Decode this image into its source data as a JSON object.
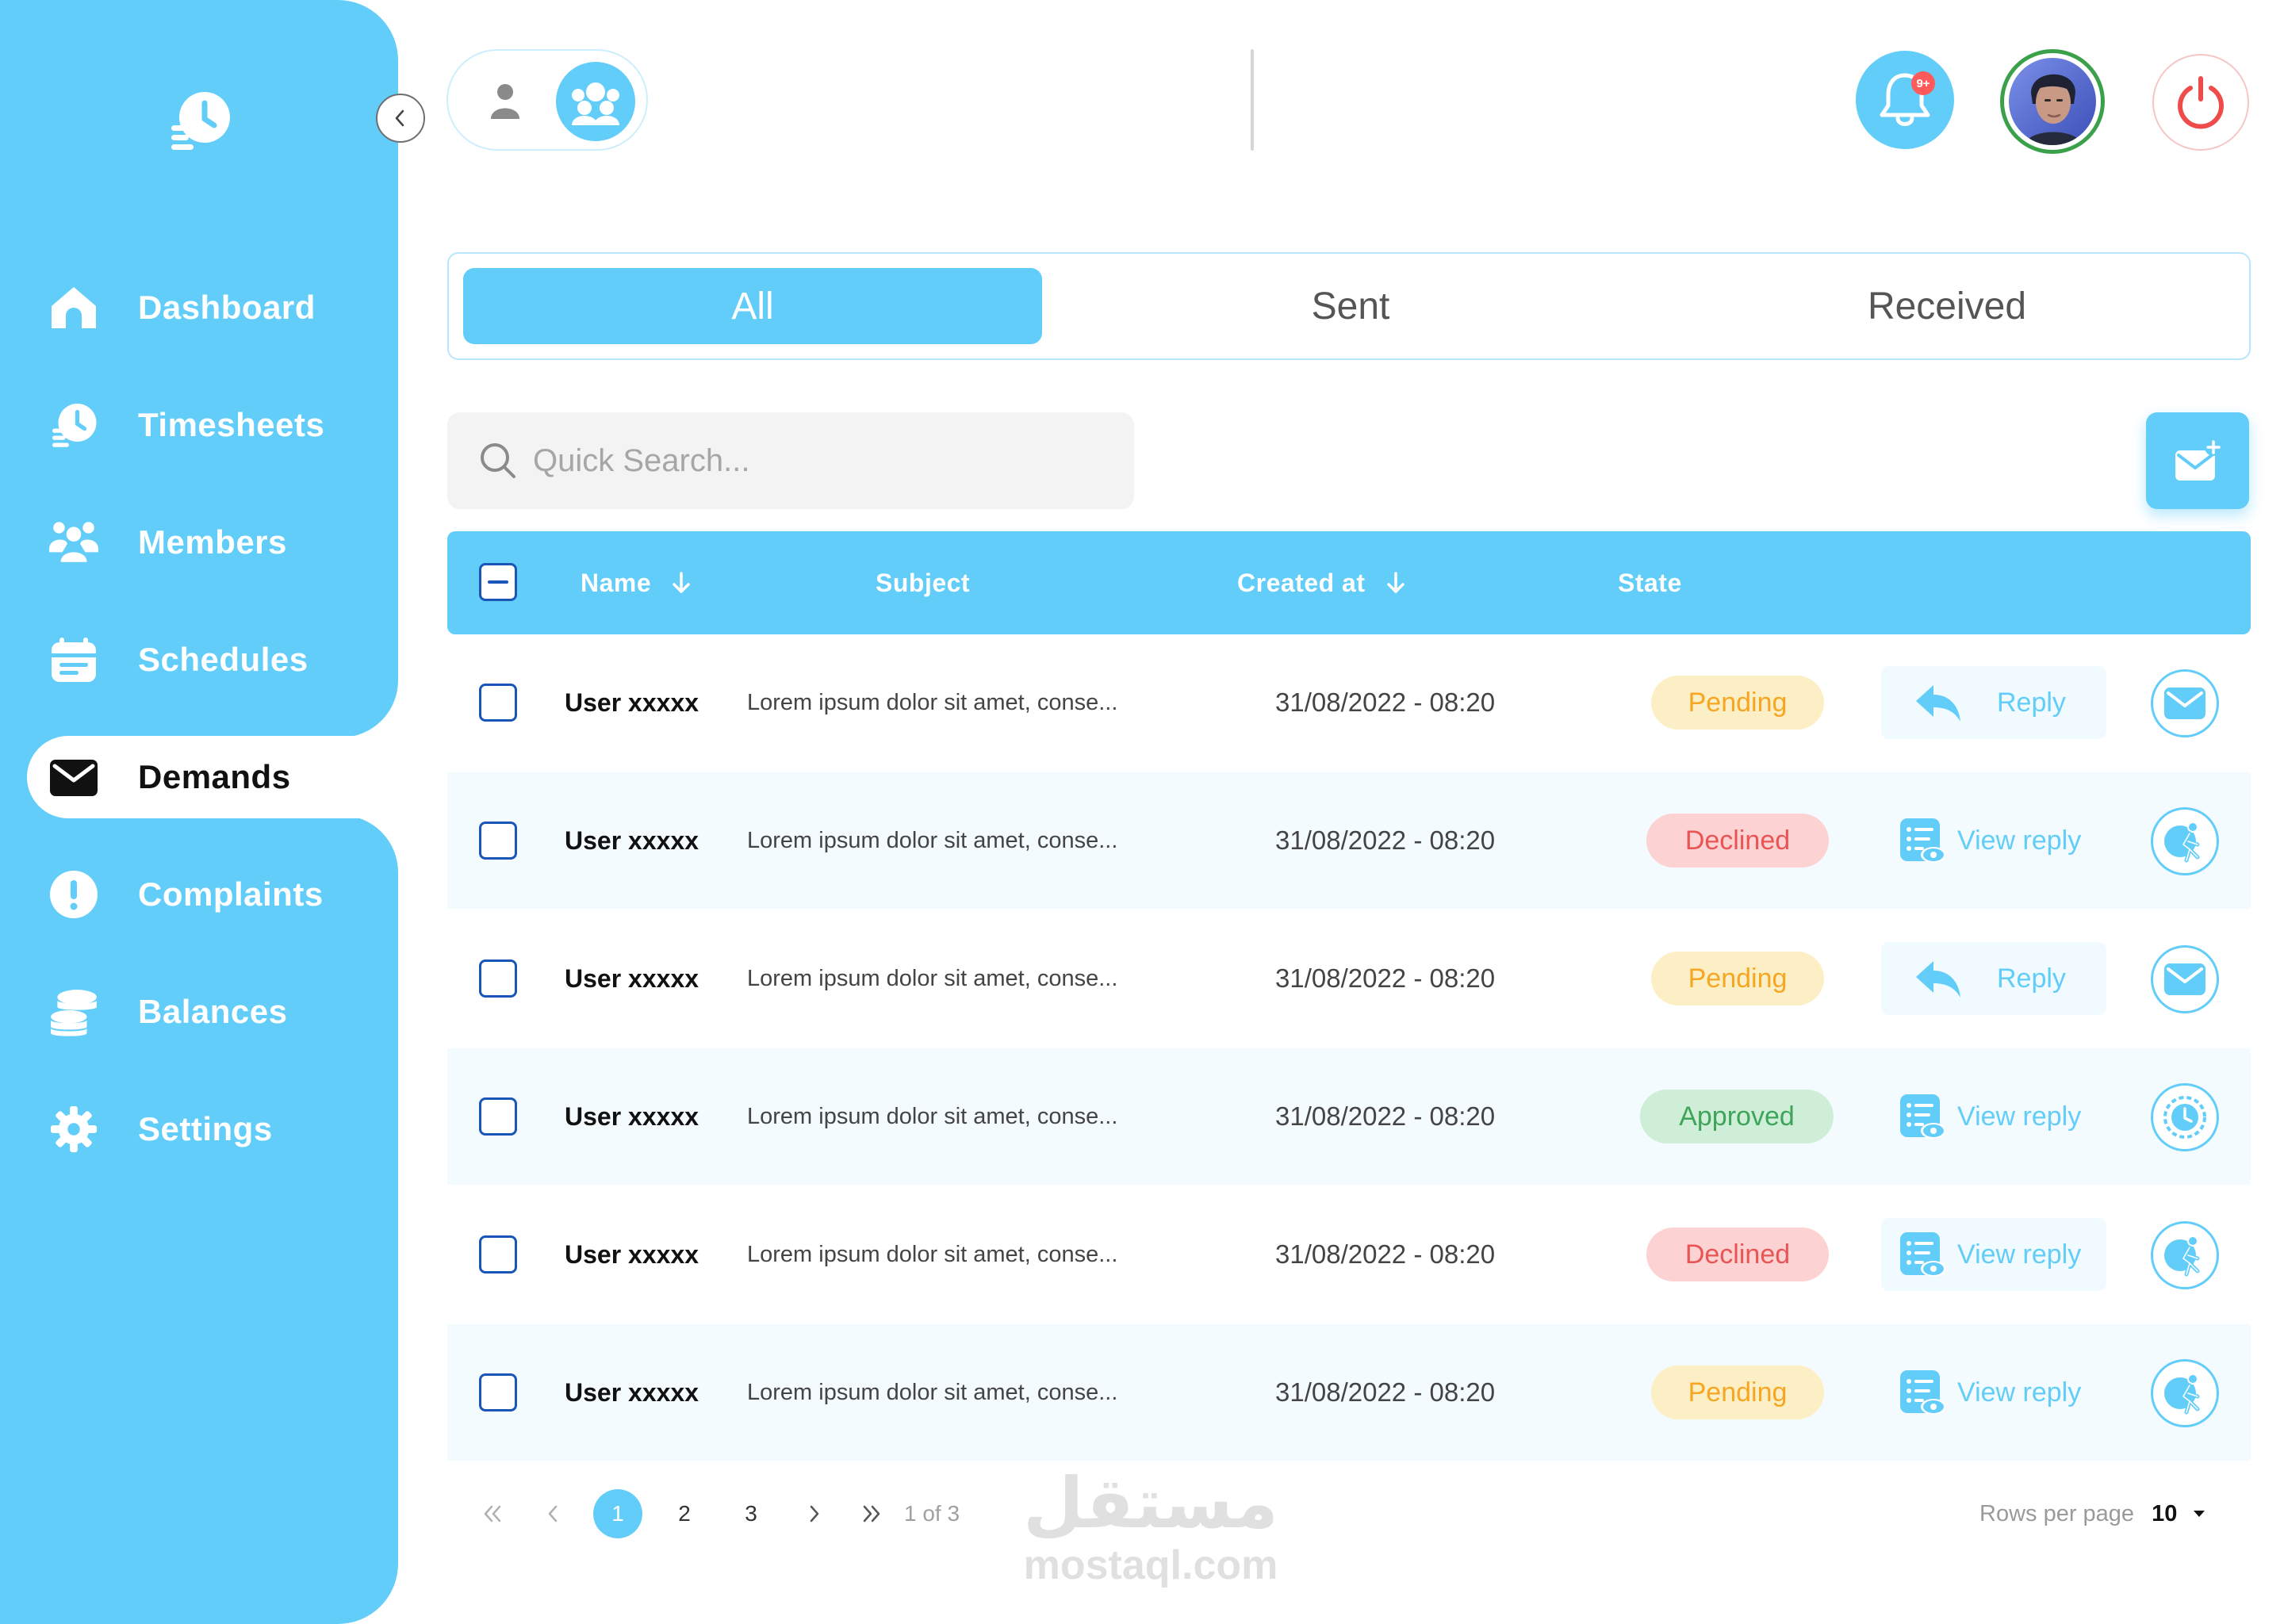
{
  "sidebar": {
    "items": [
      {
        "label": "Dashboard",
        "icon": "home-icon"
      },
      {
        "label": "Timesheets",
        "icon": "timesheet-icon"
      },
      {
        "label": "Members",
        "icon": "members-icon"
      },
      {
        "label": "Schedules",
        "icon": "calendar-icon"
      },
      {
        "label": "Demands",
        "icon": "mail-icon",
        "active": true
      },
      {
        "label": "Complaints",
        "icon": "alert-icon"
      },
      {
        "label": "Balances",
        "icon": "coins-icon"
      },
      {
        "label": "Settings",
        "icon": "gear-icon"
      }
    ]
  },
  "header": {
    "notifications_badge": "9+"
  },
  "tabs": [
    {
      "label": "All",
      "active": true
    },
    {
      "label": "Sent"
    },
    {
      "label": "Received"
    }
  ],
  "search": {
    "placeholder": "Quick Search..."
  },
  "table": {
    "columns": {
      "name": "Name",
      "subject": "Subject",
      "created_at": "Created at",
      "state": "State"
    },
    "rows": [
      {
        "name": "User xxxxx",
        "subject": "Lorem ipsum dolor sit amet, conse...",
        "date": "31/08/2022 - 08:20",
        "state": "Pending",
        "action": "Reply",
        "type_icon": "envelope-icon"
      },
      {
        "name": "User xxxxx",
        "subject": "Lorem ipsum dolor sit amet, conse...",
        "date": "31/08/2022 - 08:20",
        "state": "Declined",
        "action": "View reply",
        "type_icon": "leave-icon"
      },
      {
        "name": "User xxxxx",
        "subject": "Lorem ipsum dolor sit amet, conse...",
        "date": "31/08/2022 - 08:20",
        "state": "Pending",
        "action": "Reply",
        "type_icon": "envelope-icon"
      },
      {
        "name": "User xxxxx",
        "subject": "Lorem ipsum dolor sit amet, conse...",
        "date": "31/08/2022 - 08:20",
        "state": "Approved",
        "action": "View reply",
        "type_icon": "clock-icon"
      },
      {
        "name": "User xxxxx",
        "subject": "Lorem ipsum dolor sit amet, conse...",
        "date": "31/08/2022 - 08:20",
        "state": "Declined",
        "action": "View reply",
        "type_icon": "leave-icon"
      },
      {
        "name": "User xxxxx",
        "subject": "Lorem ipsum dolor sit amet, conse...",
        "date": "31/08/2022 - 08:20",
        "state": "Pending",
        "action": "View reply",
        "type_icon": "leave-icon"
      }
    ]
  },
  "pagination": {
    "pages": [
      "1",
      "2",
      "3"
    ],
    "current": "1",
    "info": "1 of 3",
    "rows_per_page_label": "Rows per page",
    "rows_per_page_value": "10"
  },
  "watermark": {
    "arabic": "مستقل",
    "latin": "mostaql.com"
  },
  "colors": {
    "primary": "#62cdf9",
    "pending": "#f6a623",
    "declined": "#e95555",
    "approved": "#3ea45a",
    "checkbox": "#1a56b8"
  }
}
